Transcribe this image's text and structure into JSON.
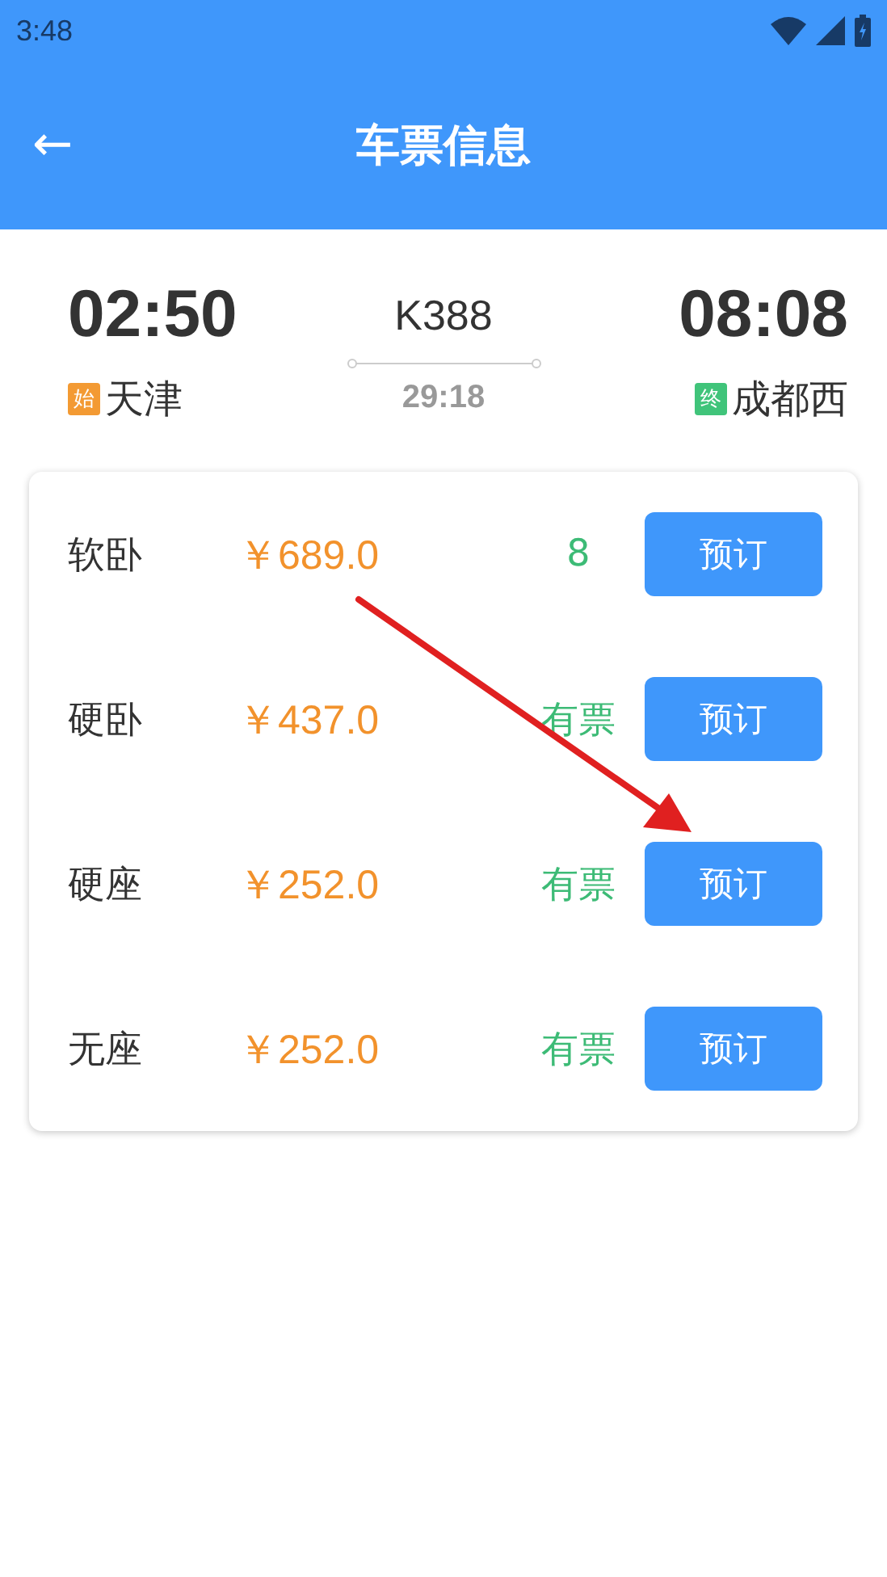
{
  "status_bar": {
    "time": "3:48"
  },
  "toolbar": {
    "back_icon": "←",
    "title": "车票信息"
  },
  "train": {
    "depart_time": "02:50",
    "number": "K388",
    "arrive_time": "08:08",
    "duration": "29:18",
    "from_tag": "始",
    "from": "天津",
    "to_tag": "终",
    "to": "成都西"
  },
  "seats": [
    {
      "name": "软卧",
      "price": "￥689.0",
      "availability": "8",
      "button": "预订"
    },
    {
      "name": "硬卧",
      "price": "￥437.0",
      "availability": "有票",
      "button": "预订"
    },
    {
      "name": "硬座",
      "price": "￥252.0",
      "availability": "有票",
      "button": "预订"
    },
    {
      "name": "无座",
      "price": "￥252.0",
      "availability": "有票",
      "button": "预订"
    }
  ]
}
